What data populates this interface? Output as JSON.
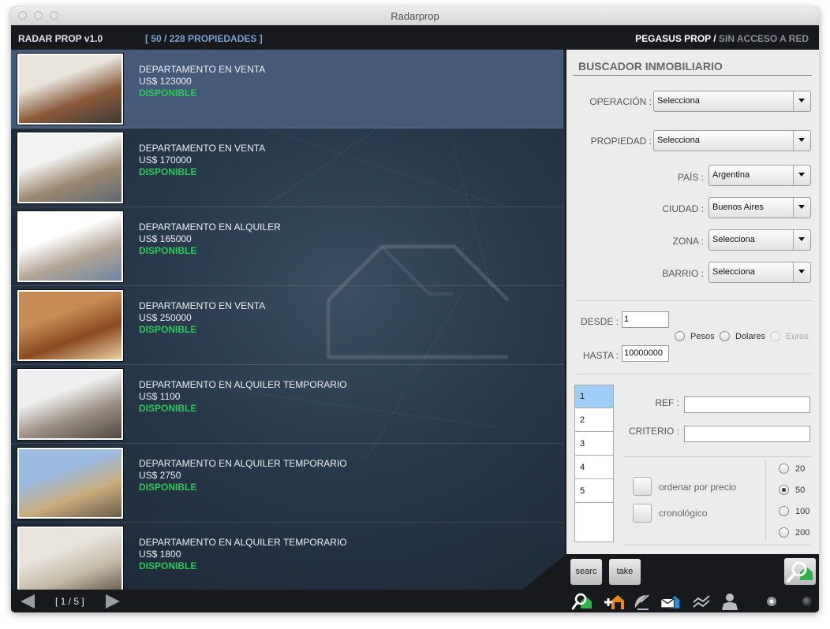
{
  "window": {
    "title": "Radarprop"
  },
  "header": {
    "app_name": "RADAR PROP v1.0",
    "count": "[ 50 / 228 PROPIEDADES ]",
    "brand": "PEGASUS PROP",
    "brand_sep": " / ",
    "network": "SIN ACCESO A RED"
  },
  "listings": [
    {
      "title": "DEPARTAMENTO EN VENTA",
      "price": "US$ 123000",
      "status": "DISPONIBLE",
      "selected": true
    },
    {
      "title": "DEPARTAMENTO EN VENTA",
      "price": "US$ 170000",
      "status": "DISPONIBLE",
      "selected": false
    },
    {
      "title": "DEPARTAMENTO EN ALQUILER",
      "price": "US$ 165000",
      "status": "DISPONIBLE",
      "selected": false
    },
    {
      "title": "DEPARTAMENTO EN VENTA",
      "price": "US$ 250000",
      "status": "DISPONIBLE",
      "selected": false
    },
    {
      "title": "DEPARTAMENTO EN ALQUILER TEMPORARIO",
      "price": "US$ 1100",
      "status": "DISPONIBLE",
      "selected": false
    },
    {
      "title": "DEPARTAMENTO EN ALQUILER TEMPORARIO",
      "price": "US$ 2750",
      "status": "DISPONIBLE",
      "selected": false
    },
    {
      "title": "DEPARTAMENTO EN ALQUILER TEMPORARIO",
      "price": "US$ 1800",
      "status": "DISPONIBLE",
      "selected": false
    }
  ],
  "search": {
    "title": "BUSCADOR INMOBILIARIO",
    "operacion": {
      "label": "OPERACIÓN :",
      "value": "Selecciona"
    },
    "propiedad": {
      "label": "PROPIEDAD :",
      "value": "Selecciona"
    },
    "pais": {
      "label": "PAÍS :",
      "value": "Argentina"
    },
    "ciudad": {
      "label": "CIUDAD :",
      "value": "Buenos Aires"
    },
    "zona": {
      "label": "ZONA :",
      "value": "Selecciona"
    },
    "barrio": {
      "label": "BARRIO :",
      "value": "Selecciona"
    },
    "desde": {
      "label": "DESDE :",
      "value": "1"
    },
    "hasta": {
      "label": "HASTA :",
      "value": "10000000"
    },
    "currency": [
      {
        "label": "Pesos",
        "checked": false,
        "enabled": true
      },
      {
        "label": "Dolares",
        "checked": false,
        "enabled": true
      },
      {
        "label": "Euros",
        "checked": false,
        "enabled": false
      }
    ],
    "pages": [
      "1",
      "2",
      "3",
      "4",
      "5"
    ],
    "selected_page": "1",
    "ref": {
      "label": "REF :",
      "value": ""
    },
    "criterio": {
      "label": "CRITERIO :",
      "value": ""
    },
    "order_price": {
      "label": "ordenar por precio",
      "checked": false
    },
    "chronological": {
      "label": "cronológico",
      "checked": false
    },
    "limits": [
      {
        "label": "20",
        "checked": false
      },
      {
        "label": "50",
        "checked": true
      },
      {
        "label": "100",
        "checked": false
      },
      {
        "label": "200",
        "checked": false
      }
    ]
  },
  "actions": {
    "search_label": "searc",
    "take_label": "take",
    "go_icon": "search-house-icon"
  },
  "footer": {
    "pager": "[ 1 / 5 ]",
    "icons": [
      "search-house-icon",
      "add-house-icon",
      "satellite-dish-icon",
      "mail-house-icon",
      "chart-icon",
      "user-icon"
    ]
  },
  "colors": {
    "accent_green": "#2fc65a",
    "selected_row": "#455a79",
    "count_blue": "#7aa3d8",
    "icon_green": "#22a33a",
    "icon_orange": "#e88a1a",
    "icon_blue": "#2a8fd8"
  }
}
